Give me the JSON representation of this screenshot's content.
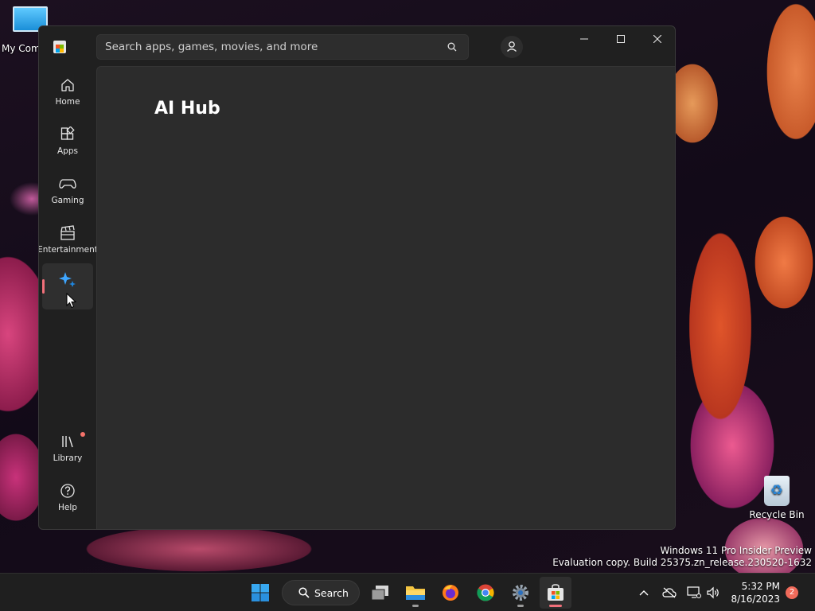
{
  "desktop": {
    "my_computer_label": "My Com",
    "recycle_bin_label": "Recycle Bin",
    "watermark_line1": "Windows 11 Pro Insider Preview",
    "watermark_line2": "Evaluation copy. Build 25375.zn_release.230520-1632"
  },
  "window": {
    "search_placeholder": "Search apps, games, movies, and more",
    "nav": [
      {
        "label": "Home",
        "icon": "home-icon"
      },
      {
        "label": "Apps",
        "icon": "apps-icon"
      },
      {
        "label": "Gaming",
        "icon": "gaming-icon"
      },
      {
        "label": "Entertainment",
        "icon": "entertainment-icon"
      },
      {
        "label": "",
        "icon": "ai-hub-sparkle-icon",
        "active": true
      },
      {
        "label": "Library",
        "icon": "library-icon",
        "has_badge": true
      },
      {
        "label": "Help",
        "icon": "help-icon"
      }
    ],
    "page_title": "AI Hub"
  },
  "taskbar": {
    "search_label": "Search",
    "time": "5:32 PM",
    "date": "8/16/2023",
    "notification_count": "2",
    "accent_color": "#f1707a"
  }
}
